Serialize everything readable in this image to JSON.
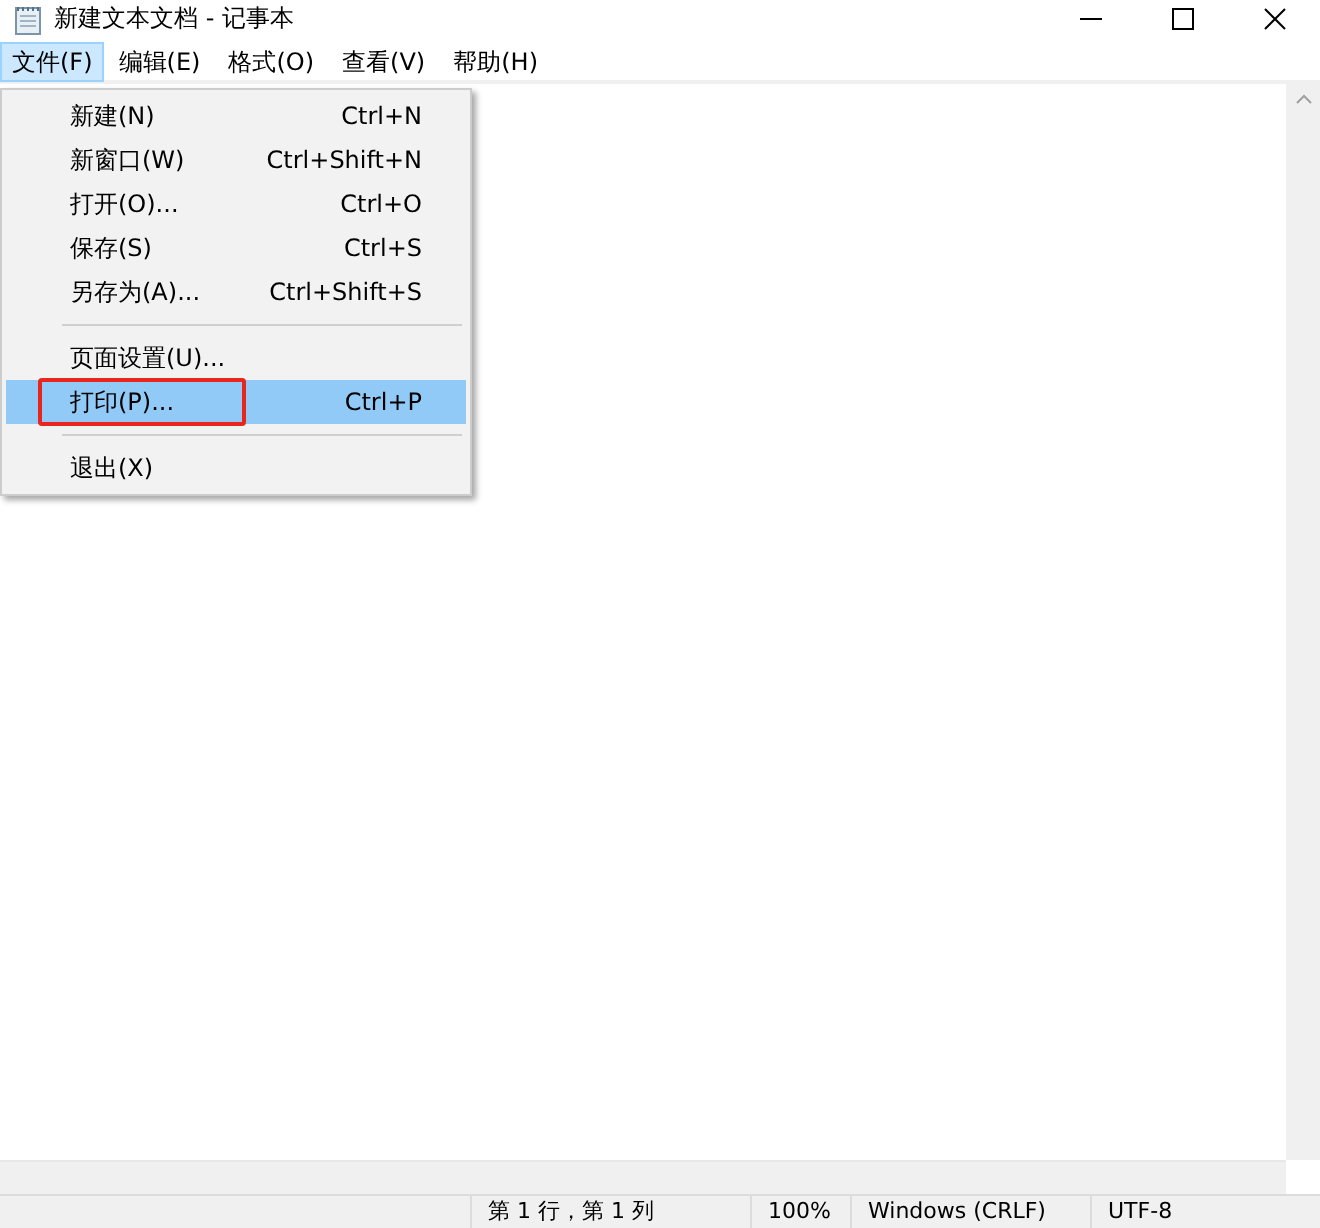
{
  "window": {
    "title": "新建文本文档 - 记事本"
  },
  "menu_bar": [
    {
      "label": "文件(F)",
      "selected": true
    },
    {
      "label": "编辑(E)",
      "selected": false
    },
    {
      "label": "格式(O)",
      "selected": false
    },
    {
      "label": "查看(V)",
      "selected": false
    },
    {
      "label": "帮助(H)",
      "selected": false
    }
  ],
  "file_menu": [
    {
      "kind": "item",
      "label": "新建(N)",
      "shortcut": "Ctrl+N",
      "selected": false
    },
    {
      "kind": "item",
      "label": "新窗口(W)",
      "shortcut": "Ctrl+Shift+N",
      "selected": false
    },
    {
      "kind": "item",
      "label": "打开(O)...",
      "shortcut": "Ctrl+O",
      "selected": false
    },
    {
      "kind": "item",
      "label": "保存(S)",
      "shortcut": "Ctrl+S",
      "selected": false
    },
    {
      "kind": "item",
      "label": "另存为(A)...",
      "shortcut": "Ctrl+Shift+S",
      "selected": false
    },
    {
      "kind": "separator"
    },
    {
      "kind": "item",
      "label": "页面设置(U)...",
      "selected": false
    },
    {
      "kind": "item",
      "label": "打印(P)...",
      "shortcut": "Ctrl+P",
      "selected": true,
      "outlined": true
    },
    {
      "kind": "separator"
    },
    {
      "kind": "item",
      "label": "退出(X)",
      "selected": false
    }
  ],
  "status_bar": [
    "第 1 行，第 1 列",
    "100%",
    "Windows (CRLF)",
    "UTF-8"
  ]
}
